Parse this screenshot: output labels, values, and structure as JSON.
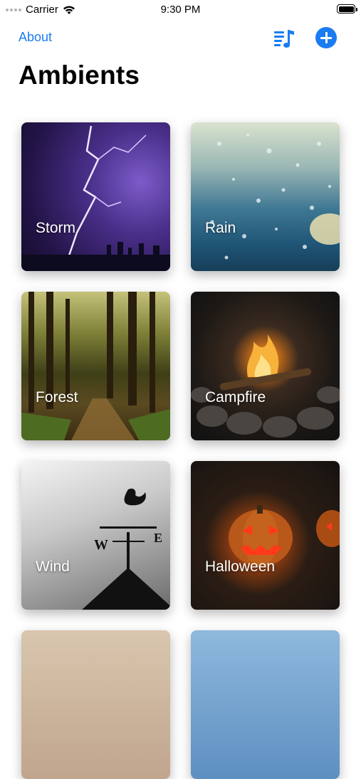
{
  "status_bar": {
    "carrier": "Carrier",
    "time": "9:30 PM"
  },
  "nav": {
    "about_label": "About"
  },
  "page": {
    "title": "Ambients"
  },
  "ambients": [
    {
      "label": "Storm"
    },
    {
      "label": "Rain"
    },
    {
      "label": "Forest"
    },
    {
      "label": "Campfire"
    },
    {
      "label": "Wind"
    },
    {
      "label": "Halloween"
    }
  ],
  "colors": {
    "accent": "#1a7cf0",
    "title": "#000000"
  },
  "icons": {
    "playlist": "music-list-icon",
    "add": "plus-circle-icon",
    "wifi": "wifi-icon",
    "battery": "battery-icon"
  }
}
